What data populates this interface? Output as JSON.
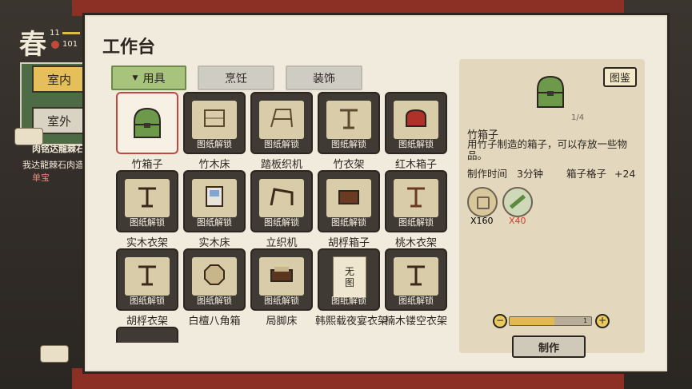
{
  "hud": {
    "season": "春",
    "stat_top": "11",
    "stat_coins": "101",
    "tab_indoor": "室内",
    "tab_outdoor": "室外",
    "quest_title": "肉铭达龍棘石",
    "quest_line1": "我达龍棘石肉造设",
    "quest_line2": "单宝"
  },
  "panel": {
    "title": "工作台",
    "tabs": [
      {
        "label": "用具",
        "active": true
      },
      {
        "label": "烹饪",
        "active": false
      },
      {
        "label": "装饰",
        "active": false
      }
    ],
    "items": [
      {
        "name": "竹箱子",
        "lock": "",
        "selected": true,
        "icon": "bamboo-box"
      },
      {
        "name": "竹木床",
        "lock": "图纸解锁",
        "icon": "bamboo-bed"
      },
      {
        "name": "踏板织机",
        "lock": "图纸解锁",
        "icon": "treadle-loom"
      },
      {
        "name": "竹衣架",
        "lock": "图纸解锁",
        "icon": "bamboo-rack"
      },
      {
        "name": "红木箱子",
        "lock": "图纸解锁",
        "icon": "red-box"
      },
      {
        "name": "实木衣架",
        "lock": "图纸解锁",
        "icon": "wood-rack"
      },
      {
        "name": "实木床",
        "lock": "图纸解锁",
        "icon": "wood-bed"
      },
      {
        "name": "立织机",
        "lock": "图纸解锁",
        "icon": "vertical-loom"
      },
      {
        "name": "胡桴箱子",
        "lock": "图纸解锁",
        "icon": "walnut-box"
      },
      {
        "name": "桃木衣架",
        "lock": "图纸解锁",
        "icon": "peach-rack"
      },
      {
        "name": "胡桴衣架",
        "lock": "图纸解锁",
        "icon": "walnut-rack"
      },
      {
        "name": "白檀八角箱",
        "lock": "图纸解锁",
        "icon": "octagon-box"
      },
      {
        "name": "局脚床",
        "lock": "图纸解锁",
        "icon": "footed-bed"
      },
      {
        "name": "韩熙载夜宴衣架",
        "lock": "图纸解锁",
        "icon": "scroll-unknown",
        "placeholder_text": "无\n图"
      },
      {
        "name": "楠木镂空衣架",
        "lock": "图纸解锁",
        "icon": "nanmu-rack"
      }
    ]
  },
  "detail": {
    "atlas_label": "图鉴",
    "page": "1/4",
    "name": "竹箱子",
    "description": "用竹子制造的箱子，可以存放一些物品。",
    "time_label": "制作时间",
    "time_value": "3分钟",
    "slot_label": "箱子格子",
    "slot_value": "+24",
    "materials": [
      {
        "icon": "coin-icon",
        "qty": "X160",
        "color": "#2b2620"
      },
      {
        "icon": "bamboo-icon",
        "qty": "X40",
        "color": "#d23b2e"
      }
    ],
    "quantity": "1",
    "quantity_fraction": 0.55,
    "make_label": "制作"
  }
}
